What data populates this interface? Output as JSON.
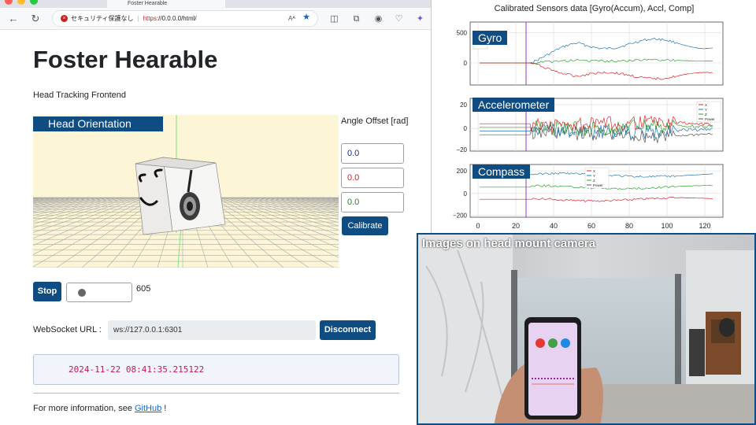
{
  "browser": {
    "tab_title": "Foster Hearable",
    "address_warning": "セキュリティ保護なし",
    "address_scheme": "https",
    "address_rest": "://0.0.0.0/html/",
    "reader_glyph": "Aᴬ"
  },
  "page": {
    "title": "Foster Hearable",
    "subtitle": "Head Tracking Frontend",
    "viewer_label": "Head Orientation",
    "angle_offset_label": "Angle Offset [rad]",
    "angle_x": "0.0",
    "angle_y": "0.0",
    "angle_z": "0.0",
    "angle_colors": {
      "x": "#1a2a8c",
      "y": "#c62828",
      "z": "#2e7d32"
    },
    "calibrate_label": "Calibrate",
    "stop_label": "Stop",
    "count": "605",
    "ws_label": "WebSocket URL :",
    "ws_value": "ws://127.0.0.1:6301",
    "disconnect_label": "Disconnect",
    "timestamp": "2024-11-22 08:41:35.215122",
    "footer_prefix": "For more information, see ",
    "footer_link": "GitHub",
    "footer_suffix": " !"
  },
  "plots": {
    "title": "Calibrated Sensors data [Gyro(Accum), Accl, Comp]",
    "x_ticks": [
      "0",
      "20",
      "40",
      "60",
      "80",
      "100",
      "120"
    ],
    "panels": [
      {
        "name": "Gyro",
        "y_ticks": [
          "500",
          "0"
        ]
      },
      {
        "name": "Accelerometer",
        "y_ticks": [
          "20",
          "0",
          "−20"
        ],
        "legend": [
          "X",
          "Y",
          "Z",
          "Power"
        ]
      },
      {
        "name": "Compass",
        "y_ticks": [
          "200",
          "0",
          "−200"
        ],
        "legend": [
          "X",
          "Y",
          "Z",
          "Power"
        ]
      }
    ]
  },
  "camera": {
    "title": "Images on head mount camera"
  },
  "colors": {
    "brand": "#0f4c81",
    "series_x": "#d62728",
    "series_y": "#1f77b4",
    "series_z": "#2ca02c",
    "series_power": "#555555",
    "marker": "#9b30c8"
  }
}
